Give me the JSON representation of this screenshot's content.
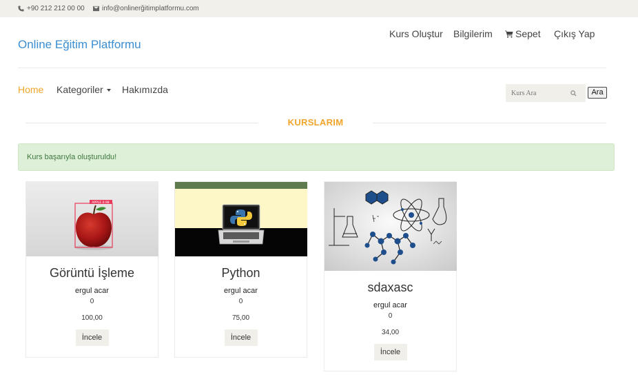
{
  "topbar": {
    "phone": "+90 212 212 00 00",
    "email": "info@onlinerğitimplatformu.com"
  },
  "brand": "Online Eğitim Platformu",
  "topnav": [
    {
      "label": "Kurs Oluştur"
    },
    {
      "label": "Bilgilerim"
    },
    {
      "label": "Sepet"
    },
    {
      "label": "Çıkış Yap"
    }
  ],
  "mainnav": [
    {
      "label": "Home",
      "active": true
    },
    {
      "label": "Kategoriler"
    },
    {
      "label": "Hakımızda"
    }
  ],
  "search": {
    "placeholder": "Kurs Ara",
    "button": "Ara"
  },
  "section": {
    "title": "KURSLARIM"
  },
  "alert": {
    "message": "Kurs başarıyla oluşturuldu!"
  },
  "courses": [
    {
      "title": "Görüntü İşleme",
      "author": "ergul acar",
      "count": "0",
      "price": "100,00",
      "button": "İncele",
      "image_tag": "APPLE 0.98"
    },
    {
      "title": "Python",
      "author": "ergul acar",
      "count": "0",
      "price": "75,00",
      "button": "İncele"
    },
    {
      "title": "sdaxasc",
      "author": "ergul acar",
      "count": "0",
      "price": "34,00",
      "button": "İncele"
    }
  ],
  "colors": {
    "brand": "#3a8ed2",
    "accent": "#f0a52a",
    "alert_bg": "#dff0d8",
    "alert_text": "#3c763d"
  }
}
